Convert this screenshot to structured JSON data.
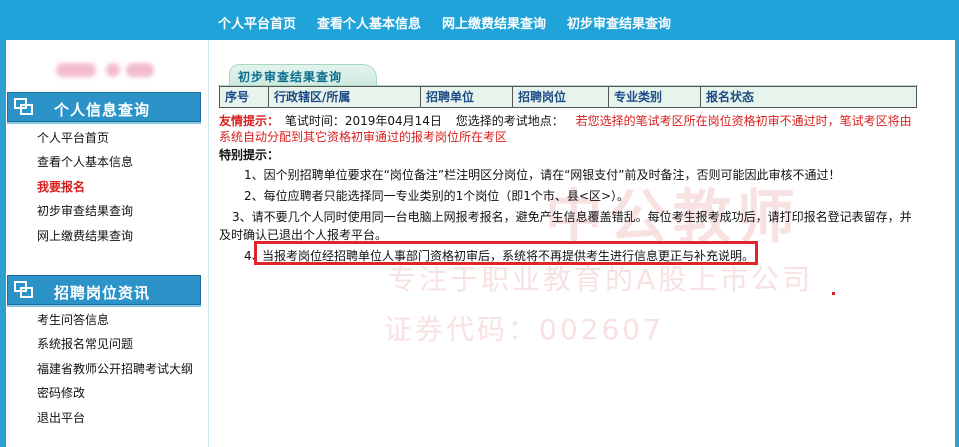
{
  "topnav": {
    "links": [
      "个人平台首页",
      "查看个人基本信息",
      "网上缴费结果查询",
      "初步审查结果查询"
    ]
  },
  "sidebar": {
    "panel1": {
      "title": "个人信息查询",
      "items": [
        {
          "label": "个人平台首页",
          "active": false
        },
        {
          "label": "查看个人基本信息",
          "active": false
        },
        {
          "label": "我要报名",
          "active": true
        },
        {
          "label": "初步审查结果查询",
          "active": false
        },
        {
          "label": "网上缴费结果查询",
          "active": false
        }
      ]
    },
    "panel2": {
      "title": "招聘岗位资讯",
      "items": [
        {
          "label": "考生问答信息"
        },
        {
          "label": "系统报名常见问题"
        },
        {
          "label": "福建省教师公开招聘考试大纲"
        },
        {
          "label": "密码修改"
        },
        {
          "label": "退出平台"
        }
      ]
    }
  },
  "main": {
    "tab_title": "初步审查结果查询",
    "table_headers": [
      "序号",
      "行政辖区/所属",
      "招聘单位",
      "招聘岗位",
      "专业类别",
      "报名状态"
    ],
    "tips": {
      "label": "友情提示：",
      "exam_time_text": "笔试时间：2019年04月14日",
      "exam_location_text": "您选择的考试地点：",
      "warning_line1": "若您选择的笔试考区所在岗位资格初审不通过时，笔试考区将由",
      "warning_line2": "系统自动分配到其它资格初审通过的报考岗位所在考区"
    },
    "special": {
      "label": "特别提示：",
      "item1": "1、因个别招聘单位要求在“岗位备注”栏注明区分岗位，请在“网银支付”前及时备注，否则可能因此审核不通过！",
      "item2": "2、每位应聘者只能选择同一专业类别的1个岗位（即1个市、县<区>）。",
      "item3_line1": "3、请不要几个人同时使用同一台电脑上网报考报名，避免产生信息覆盖错乱。每位考生报考成功后，请打印报名登记表留存，并",
      "item3_line2": "及时确认已退出个人报考平台。",
      "item4_num": "4、",
      "item4_text": "当报考岗位经招聘单位人事部门资格初审后，系统将不再提供考生进行信息更正与补充说明。"
    },
    "watermark": {
      "line1": "专注于职业教育的A股上市公司",
      "line2": "证券代码：002607",
      "brand": "中公教师"
    }
  },
  "colors": {
    "nav_blue": "#1fa3d8",
    "panel_blue": "#2b93c7",
    "warning_red": "#d81e1e",
    "highlight_red": "#e0242a",
    "table_header_bg": "#e6f4ec"
  }
}
